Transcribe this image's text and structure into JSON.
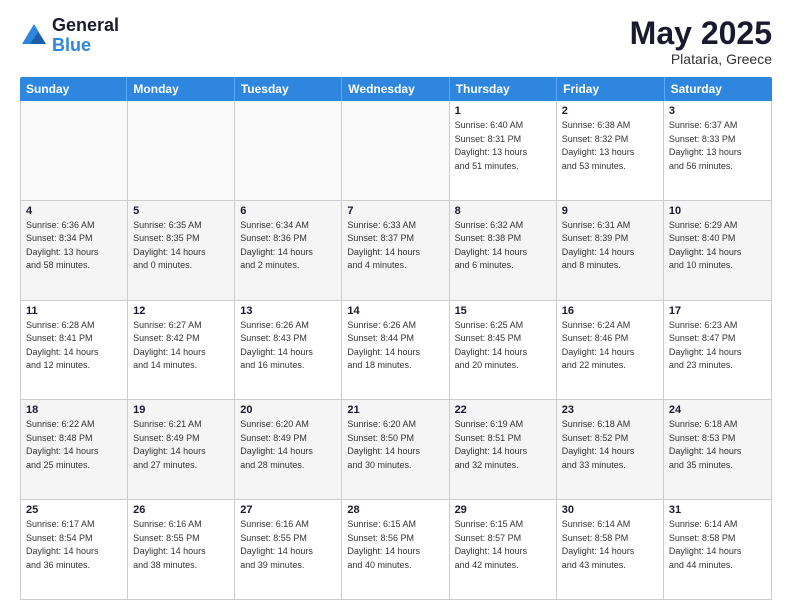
{
  "header": {
    "logo_general": "General",
    "logo_blue": "Blue",
    "month_title": "May 2025",
    "location": "Plataria, Greece"
  },
  "days_of_week": [
    "Sunday",
    "Monday",
    "Tuesday",
    "Wednesday",
    "Thursday",
    "Friday",
    "Saturday"
  ],
  "weeks": [
    [
      {
        "day": "",
        "info": ""
      },
      {
        "day": "",
        "info": ""
      },
      {
        "day": "",
        "info": ""
      },
      {
        "day": "",
        "info": ""
      },
      {
        "day": "1",
        "info": "Sunrise: 6:40 AM\nSunset: 8:31 PM\nDaylight: 13 hours\nand 51 minutes."
      },
      {
        "day": "2",
        "info": "Sunrise: 6:38 AM\nSunset: 8:32 PM\nDaylight: 13 hours\nand 53 minutes."
      },
      {
        "day": "3",
        "info": "Sunrise: 6:37 AM\nSunset: 8:33 PM\nDaylight: 13 hours\nand 56 minutes."
      }
    ],
    [
      {
        "day": "4",
        "info": "Sunrise: 6:36 AM\nSunset: 8:34 PM\nDaylight: 13 hours\nand 58 minutes."
      },
      {
        "day": "5",
        "info": "Sunrise: 6:35 AM\nSunset: 8:35 PM\nDaylight: 14 hours\nand 0 minutes."
      },
      {
        "day": "6",
        "info": "Sunrise: 6:34 AM\nSunset: 8:36 PM\nDaylight: 14 hours\nand 2 minutes."
      },
      {
        "day": "7",
        "info": "Sunrise: 6:33 AM\nSunset: 8:37 PM\nDaylight: 14 hours\nand 4 minutes."
      },
      {
        "day": "8",
        "info": "Sunrise: 6:32 AM\nSunset: 8:38 PM\nDaylight: 14 hours\nand 6 minutes."
      },
      {
        "day": "9",
        "info": "Sunrise: 6:31 AM\nSunset: 8:39 PM\nDaylight: 14 hours\nand 8 minutes."
      },
      {
        "day": "10",
        "info": "Sunrise: 6:29 AM\nSunset: 8:40 PM\nDaylight: 14 hours\nand 10 minutes."
      }
    ],
    [
      {
        "day": "11",
        "info": "Sunrise: 6:28 AM\nSunset: 8:41 PM\nDaylight: 14 hours\nand 12 minutes."
      },
      {
        "day": "12",
        "info": "Sunrise: 6:27 AM\nSunset: 8:42 PM\nDaylight: 14 hours\nand 14 minutes."
      },
      {
        "day": "13",
        "info": "Sunrise: 6:26 AM\nSunset: 8:43 PM\nDaylight: 14 hours\nand 16 minutes."
      },
      {
        "day": "14",
        "info": "Sunrise: 6:26 AM\nSunset: 8:44 PM\nDaylight: 14 hours\nand 18 minutes."
      },
      {
        "day": "15",
        "info": "Sunrise: 6:25 AM\nSunset: 8:45 PM\nDaylight: 14 hours\nand 20 minutes."
      },
      {
        "day": "16",
        "info": "Sunrise: 6:24 AM\nSunset: 8:46 PM\nDaylight: 14 hours\nand 22 minutes."
      },
      {
        "day": "17",
        "info": "Sunrise: 6:23 AM\nSunset: 8:47 PM\nDaylight: 14 hours\nand 23 minutes."
      }
    ],
    [
      {
        "day": "18",
        "info": "Sunrise: 6:22 AM\nSunset: 8:48 PM\nDaylight: 14 hours\nand 25 minutes."
      },
      {
        "day": "19",
        "info": "Sunrise: 6:21 AM\nSunset: 8:49 PM\nDaylight: 14 hours\nand 27 minutes."
      },
      {
        "day": "20",
        "info": "Sunrise: 6:20 AM\nSunset: 8:49 PM\nDaylight: 14 hours\nand 28 minutes."
      },
      {
        "day": "21",
        "info": "Sunrise: 6:20 AM\nSunset: 8:50 PM\nDaylight: 14 hours\nand 30 minutes."
      },
      {
        "day": "22",
        "info": "Sunrise: 6:19 AM\nSunset: 8:51 PM\nDaylight: 14 hours\nand 32 minutes."
      },
      {
        "day": "23",
        "info": "Sunrise: 6:18 AM\nSunset: 8:52 PM\nDaylight: 14 hours\nand 33 minutes."
      },
      {
        "day": "24",
        "info": "Sunrise: 6:18 AM\nSunset: 8:53 PM\nDaylight: 14 hours\nand 35 minutes."
      }
    ],
    [
      {
        "day": "25",
        "info": "Sunrise: 6:17 AM\nSunset: 8:54 PM\nDaylight: 14 hours\nand 36 minutes."
      },
      {
        "day": "26",
        "info": "Sunrise: 6:16 AM\nSunset: 8:55 PM\nDaylight: 14 hours\nand 38 minutes."
      },
      {
        "day": "27",
        "info": "Sunrise: 6:16 AM\nSunset: 8:55 PM\nDaylight: 14 hours\nand 39 minutes."
      },
      {
        "day": "28",
        "info": "Sunrise: 6:15 AM\nSunset: 8:56 PM\nDaylight: 14 hours\nand 40 minutes."
      },
      {
        "day": "29",
        "info": "Sunrise: 6:15 AM\nSunset: 8:57 PM\nDaylight: 14 hours\nand 42 minutes."
      },
      {
        "day": "30",
        "info": "Sunrise: 6:14 AM\nSunset: 8:58 PM\nDaylight: 14 hours\nand 43 minutes."
      },
      {
        "day": "31",
        "info": "Sunrise: 6:14 AM\nSunset: 8:58 PM\nDaylight: 14 hours\nand 44 minutes."
      }
    ]
  ]
}
